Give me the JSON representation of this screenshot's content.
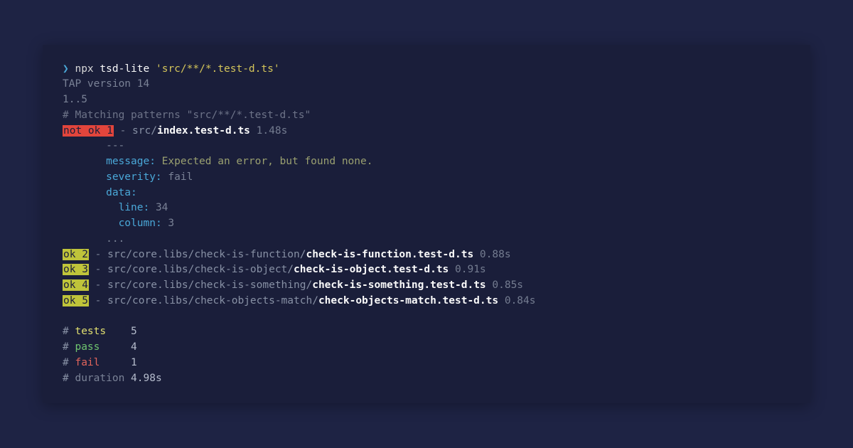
{
  "prompt_char": "❯",
  "command": {
    "runner": "npx",
    "bin": "tsd-lite",
    "arg": "'src/**/*.test-d.ts'"
  },
  "tap": {
    "version_line": "TAP version 14",
    "plan_line": "1..5",
    "matching_line": "# Matching patterns \"src/**/*.test-d.ts\""
  },
  "fail_result": {
    "badge": "not ok 1",
    "sep": " - ",
    "path_prefix": "src/",
    "path_bold": "index.test-d.ts",
    "timing": " 1.48s"
  },
  "error_block": {
    "dashes_top": "---",
    "message_key": "message:",
    "message_val": " Expected an error, but found none.",
    "severity_key": "severity:",
    "severity_val": " fail",
    "data_key": "data:",
    "line_key": "line:",
    "line_val": " 34",
    "column_key": "column:",
    "column_val": " 3",
    "dashes_bot": "..."
  },
  "pass_results": [
    {
      "badge": "ok 2",
      "sep": " - ",
      "prefix": "src/core.libs/check-is-function/",
      "bold": "check-is-function.test-d.ts",
      "timing": " 0.88s"
    },
    {
      "badge": "ok 3",
      "sep": " - ",
      "prefix": "src/core.libs/check-is-object/",
      "bold": "check-is-object.test-d.ts",
      "timing": " 0.91s"
    },
    {
      "badge": "ok 4",
      "sep": " - ",
      "prefix": "src/core.libs/check-is-something/",
      "bold": "check-is-something.test-d.ts",
      "timing": " 0.85s"
    },
    {
      "badge": "ok 5",
      "sep": " - ",
      "prefix": "src/core.libs/check-objects-match/",
      "bold": "check-objects-match.test-d.ts",
      "timing": " 0.84s"
    }
  ],
  "summary": {
    "hash": "# ",
    "tests": {
      "label": "tests",
      "spacer": "    ",
      "value": "5"
    },
    "pass": {
      "label": "pass",
      "spacer": "     ",
      "value": "4"
    },
    "fail": {
      "label": "fail",
      "spacer": "     ",
      "value": "1"
    },
    "duration": {
      "label": "duration",
      "spacer": " ",
      "value": "4.98s"
    }
  }
}
